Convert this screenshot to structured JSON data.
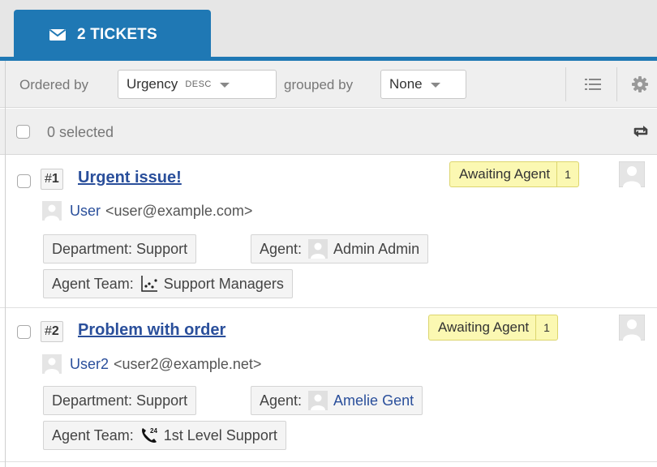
{
  "tab": {
    "icon": "envelope-icon",
    "label": "2 TICKETS"
  },
  "toolbar": {
    "ordered_by_label": "Ordered by",
    "order_value": "Urgency",
    "order_direction": "DESC",
    "grouped_by_label": "grouped by",
    "group_value": "None",
    "list_view_icon": "list-icon",
    "settings_icon": "gear-icon"
  },
  "selection": {
    "text": "0 selected",
    "refresh_icon": "refresh-icon"
  },
  "tickets": [
    {
      "number_prefix": "#",
      "number": "1",
      "subject": "Urgent issue!",
      "status": "Awaiting Agent",
      "status_count": "1",
      "user_name": "User",
      "user_email": "<user@example.com>",
      "department": "Department: Support",
      "agent_label": "Agent:",
      "agent_name": "Admin Admin",
      "team_label": "Agent Team:",
      "team_name": "Support Managers",
      "team_icon": "chart-dots-icon"
    },
    {
      "number_prefix": "#",
      "number": "2",
      "subject": "Problem with order",
      "status": "Awaiting Agent",
      "status_count": "1",
      "user_name": "User2",
      "user_email": "<user2@example.net>",
      "department": "Department: Support",
      "agent_label": "Agent:",
      "agent_name": "Amelie Gent",
      "team_label": "Agent Team:",
      "team_name": "1st Level Support",
      "team_icon": "phone-24-icon"
    }
  ],
  "colors": {
    "accent": "#1f78b4",
    "link": "#2a4f9b",
    "status_bg": "#fbf8b2"
  }
}
